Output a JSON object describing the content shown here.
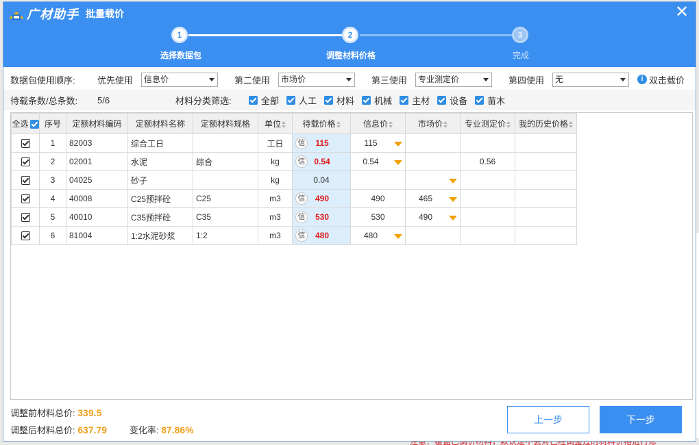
{
  "background": {
    "note": "注意：覆盖已调价材料，默认是不会对已经调整过的材料价格进行修"
  },
  "window": {
    "brand": "广材助手",
    "title": "批量载价"
  },
  "steps": [
    {
      "num": "1",
      "label": "选择数据包"
    },
    {
      "num": "2",
      "label": "调整材料价格"
    },
    {
      "num": "3",
      "label": "完成"
    }
  ],
  "order": {
    "label": "数据包使用顺序:",
    "p1_label": "优先使用",
    "p1_value": "信息价",
    "p2_label": "第二使用",
    "p2_value": "市场价",
    "p3_label": "第三使用",
    "p3_value": "专业测定价",
    "p4_label": "第四使用",
    "p4_value": "无",
    "dbl_click": "双击载价"
  },
  "filter": {
    "count_label": "待载条数/总条数:",
    "count_value": "5/6",
    "category_label": "材料分类筛选:",
    "categories": [
      "全部",
      "人工",
      "材料",
      "机械",
      "主材",
      "设备",
      "苗木"
    ]
  },
  "table": {
    "headers": [
      "全选",
      "序号",
      "定额材料编码",
      "定额材料名称",
      "定额材料规格",
      "单位",
      "待载价格",
      "信息价",
      "市场价",
      "专业测定价",
      "我的历史价格"
    ],
    "rows": [
      {
        "seq": "1",
        "code": "82003",
        "name": "综合工日",
        "spec": "",
        "unit": "工日",
        "src": "信",
        "pending": "115",
        "info": "115",
        "market": "",
        "pro": "",
        "hist": ""
      },
      {
        "seq": "2",
        "code": "02001",
        "name": "水泥",
        "spec": "综合",
        "unit": "kg",
        "src": "信",
        "pending": "0.54",
        "info": "0.54",
        "market": "",
        "pro": "0.56",
        "hist": ""
      },
      {
        "seq": "3",
        "code": "04025",
        "name": "砂子",
        "spec": "",
        "unit": "kg",
        "src": "",
        "pending": "0.04",
        "info": "",
        "market": "",
        "pro": "",
        "hist": ""
      },
      {
        "seq": "4",
        "code": "40008",
        "name": "C25预拌砼",
        "spec": "C25",
        "unit": "m3",
        "src": "信",
        "pending": "490",
        "info": "490",
        "market": "465",
        "pro": "",
        "hist": ""
      },
      {
        "seq": "5",
        "code": "40010",
        "name": "C35预拌砼",
        "spec": "C35",
        "unit": "m3",
        "src": "信",
        "pending": "530",
        "info": "530",
        "market": "490",
        "pro": "",
        "hist": ""
      },
      {
        "seq": "6",
        "code": "81004",
        "name": "1:2水泥砂浆",
        "spec": "1:2",
        "unit": "m3",
        "src": "信",
        "pending": "480",
        "info": "480",
        "market": "",
        "pro": "",
        "hist": ""
      }
    ]
  },
  "totals": {
    "before_label": "调整前材料总价:",
    "before_value": "339.5",
    "after_label": "调整后材料总价:",
    "after_value": "637.79",
    "rate_label": "变化率:",
    "rate_value": "87.86%"
  },
  "buttons": {
    "prev": "上一步",
    "next": "下一步"
  },
  "colors": {
    "header_blue": "#3b8ff0",
    "price_red": "#e01b1b",
    "total_orange": "#f0a020",
    "dropdown_orange": "#f0a000"
  }
}
